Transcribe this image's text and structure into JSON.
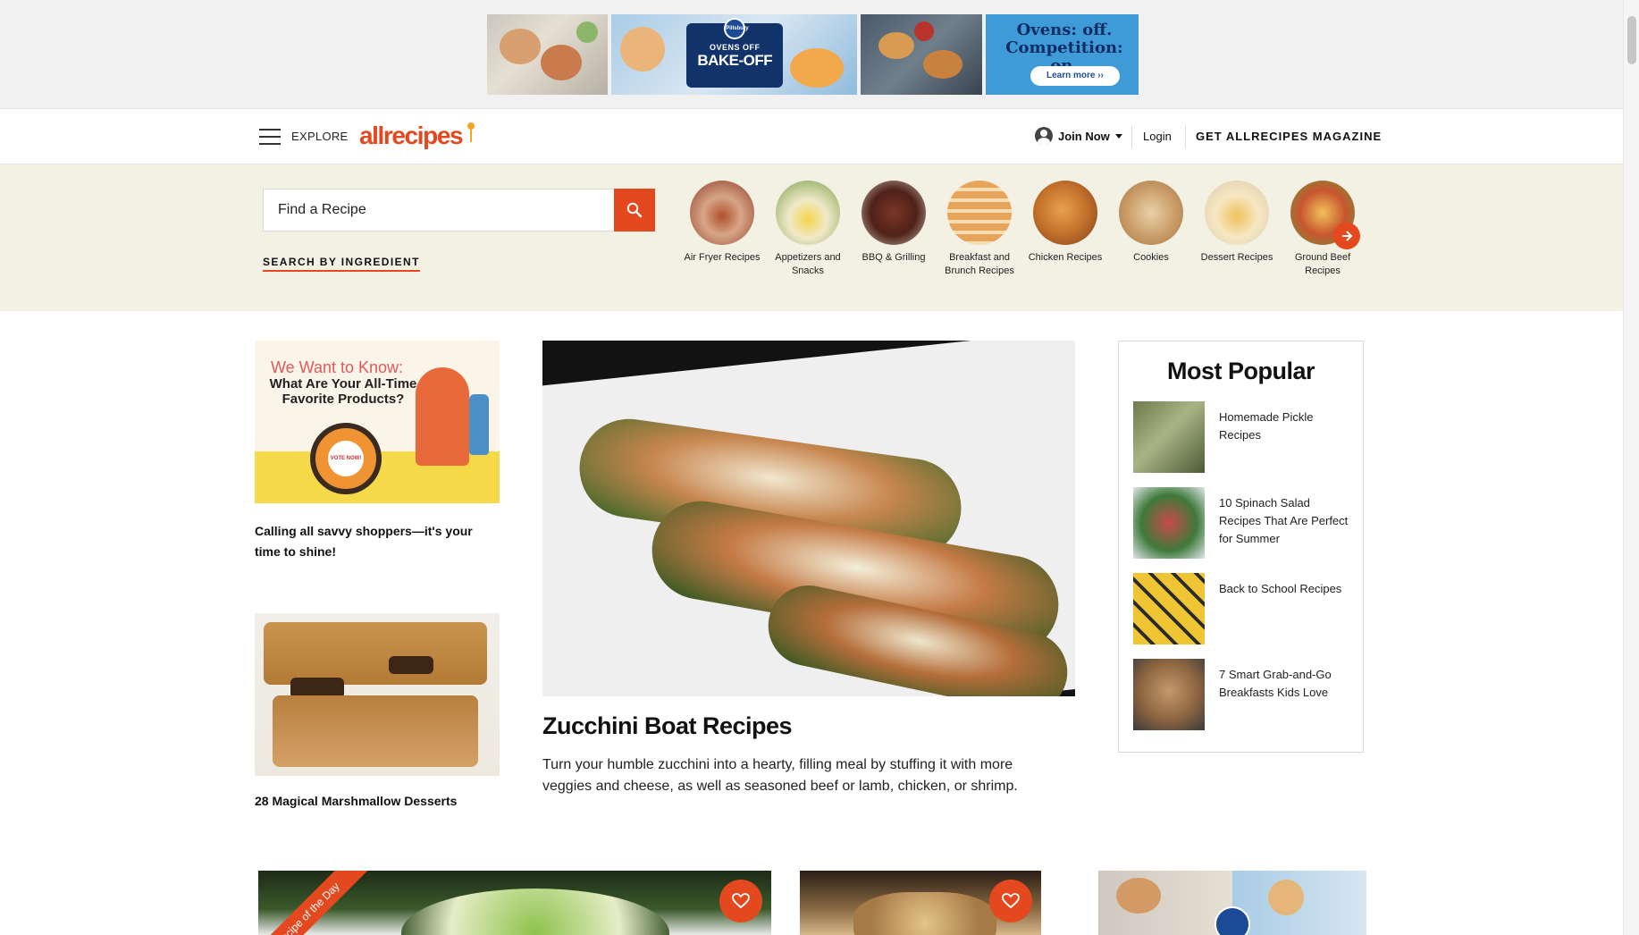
{
  "ad": {
    "bake_off_brand": "Pillsbury",
    "bake_off_line1": "OVENS OFF",
    "bake_off_line2": "BAKE-OFF",
    "headline": "Ovens: off. Competition: on.",
    "cta": "Learn more"
  },
  "header": {
    "explore_label": "EXPLORE",
    "logo_text": "allrecipes",
    "join_label": "Join Now",
    "login_label": "Login",
    "magazine_label": "GET ALLRECIPES MAGAZINE"
  },
  "search": {
    "placeholder": "Find a Recipe",
    "search_by_ingredient": "SEARCH BY INGREDIENT"
  },
  "categories": [
    {
      "label": "Air Fryer Recipes"
    },
    {
      "label": "Appetizers and Snacks"
    },
    {
      "label": "BBQ & Grilling"
    },
    {
      "label": "Breakfast and Brunch Recipes"
    },
    {
      "label": "Chicken Recipes"
    },
    {
      "label": "Cookies"
    },
    {
      "label": "Dessert Recipes"
    },
    {
      "label": "Ground Beef Recipes"
    }
  ],
  "promo": {
    "image_line1": "We Want to Know:",
    "image_line2": "What Are Your All-Time Favorite Products?",
    "badge_text": "VOTE NOW!",
    "title": "Calling all savvy shoppers—it's your time to shine!"
  },
  "dessert": {
    "title": "28 Magical Marshmallow Desserts"
  },
  "feature": {
    "title": "Zucchini Boat Recipes",
    "description": "Turn your humble zucchini into a hearty, filling meal by stuffing it with more veggies and cheese, as well as seasoned beef or lamb, chicken, or shrimp."
  },
  "most_popular": {
    "title": "Most Popular",
    "items": [
      {
        "label": "Homemade Pickle Recipes"
      },
      {
        "label": "10 Spinach Salad Recipes That Are Perfect for Summer"
      },
      {
        "label": "Back to School Recipes"
      },
      {
        "label": "7 Smart Grab-and-Go Breakfasts Kids Love"
      }
    ]
  },
  "bottom": {
    "ribbon_text": "Recipe of the Day"
  },
  "colors": {
    "brand": "#e4481f",
    "search_band": "#f2f1e3"
  }
}
